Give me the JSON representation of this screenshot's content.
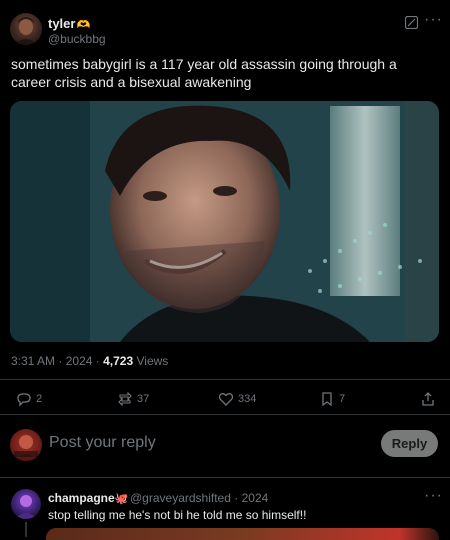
{
  "post": {
    "author_name": "tyler",
    "author_emoji": "🫶",
    "author_handle": "@buckbbg",
    "text": "sometimes babygirl is a 117 year old assassin going through a career crisis and a bisexual awakening",
    "media_icon": "video-still",
    "time": "3:31 AM",
    "year": "2024",
    "views_count": "4,723",
    "views_label": "Views",
    "more_icon": "more-horizontal-icon",
    "grok_icon": "grok-icon"
  },
  "actions": {
    "replies": "2",
    "reposts": "37",
    "likes": "334",
    "bookmarks": "7"
  },
  "reply_box": {
    "placeholder": "Post your reply",
    "button_label": "Reply"
  },
  "comment": {
    "author_name": "champagne",
    "author_emoji": "🐙",
    "author_handle": "@graveyardshifted",
    "year": "2024",
    "text": "stop telling me he's not bi he told me so himself!!"
  },
  "colors": {
    "background": "#000000",
    "text": "#e7e9ea",
    "muted": "#71767b",
    "divider": "#2f3336",
    "reply_button": "#787a7a"
  }
}
